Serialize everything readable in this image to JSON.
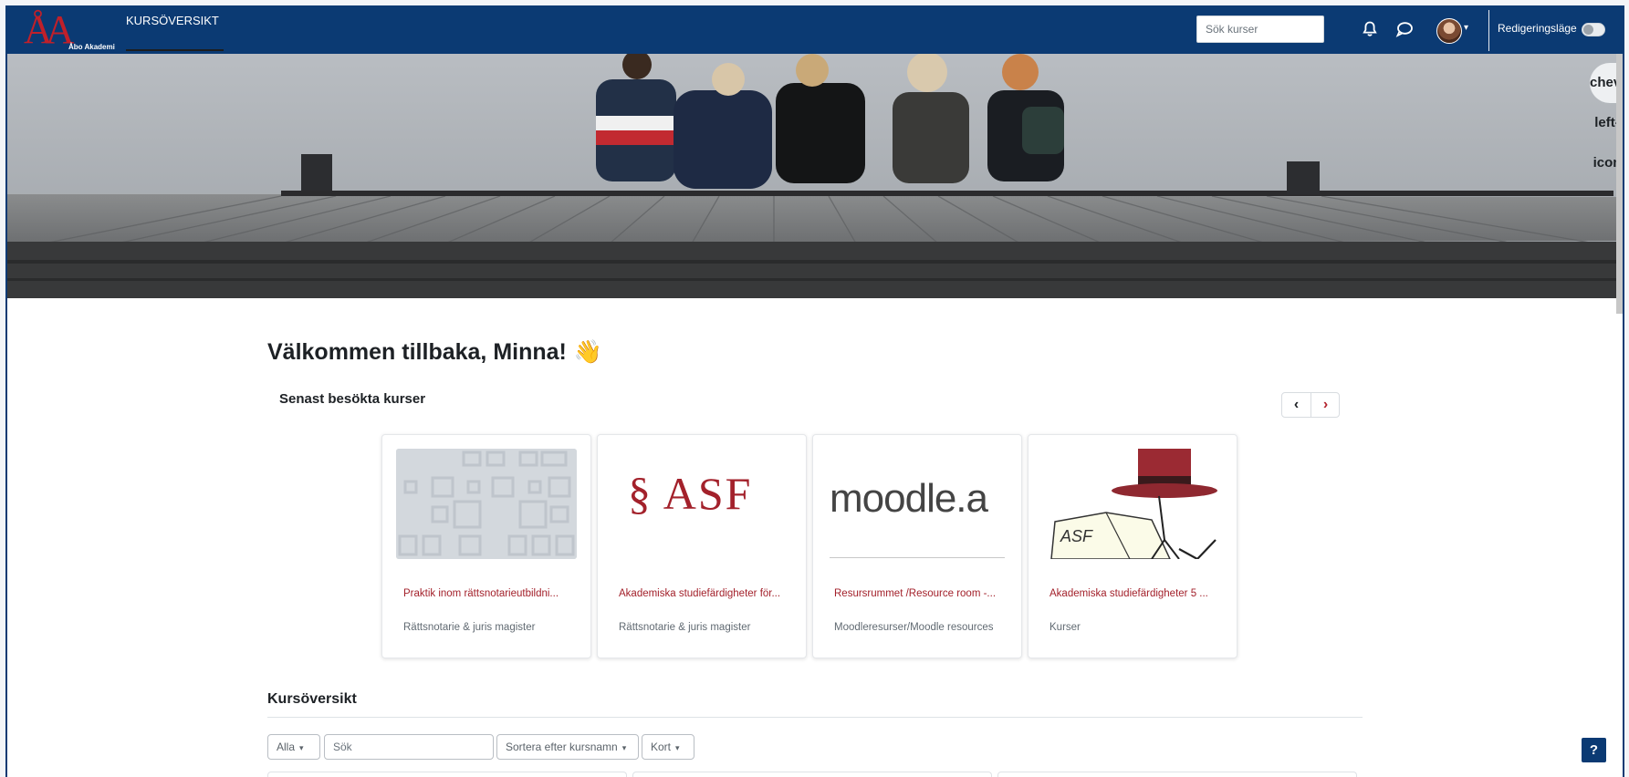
{
  "navbar": {
    "brand_mark": "ÅA",
    "brand_tag": "Åbo Akademi",
    "nav_link": "KURSÖVERSIKT",
    "search_placeholder": "Sök kurser",
    "edit_mode_label": "Redigeringsläge",
    "edit_mode_on": false,
    "colors": {
      "background": "#0b3a73",
      "brand_red": "#c0202a"
    }
  },
  "icons": {
    "bell": "bell-icon",
    "chat": "chat-icon",
    "drawer": "chevron-left-icon",
    "help": "?"
  },
  "main": {
    "welcome": "Välkommen tillbaka, Minna!",
    "wave_emoji": "👋",
    "recent_title": "Senast besökta kurser",
    "pager_prev": "‹",
    "pager_next": "›",
    "recent_courses": [
      {
        "title": "Praktik inom rättsnotarieutbildni...",
        "category": "Rättsnotarie & juris magister",
        "image": "pattern"
      },
      {
        "title": "Akademiska studiefärdigheter för...",
        "category": "Rättsnotarie & juris magister",
        "image": "§ ASF"
      },
      {
        "title": "Resursrummet /Resource room -...",
        "category": "Moodleresurser/Moodle resources",
        "image": "moodle.a"
      },
      {
        "title": "Akademiska studiefärdigheter 5 ...",
        "category": "Kurser",
        "image": "ASF"
      }
    ],
    "overview_title": "Kursöversikt",
    "filters": {
      "grouping": "Alla",
      "search_placeholder": "Sök",
      "sort": "Sortera efter kursnamn",
      "view": "Kort"
    },
    "accent_color": "#a3212b"
  }
}
